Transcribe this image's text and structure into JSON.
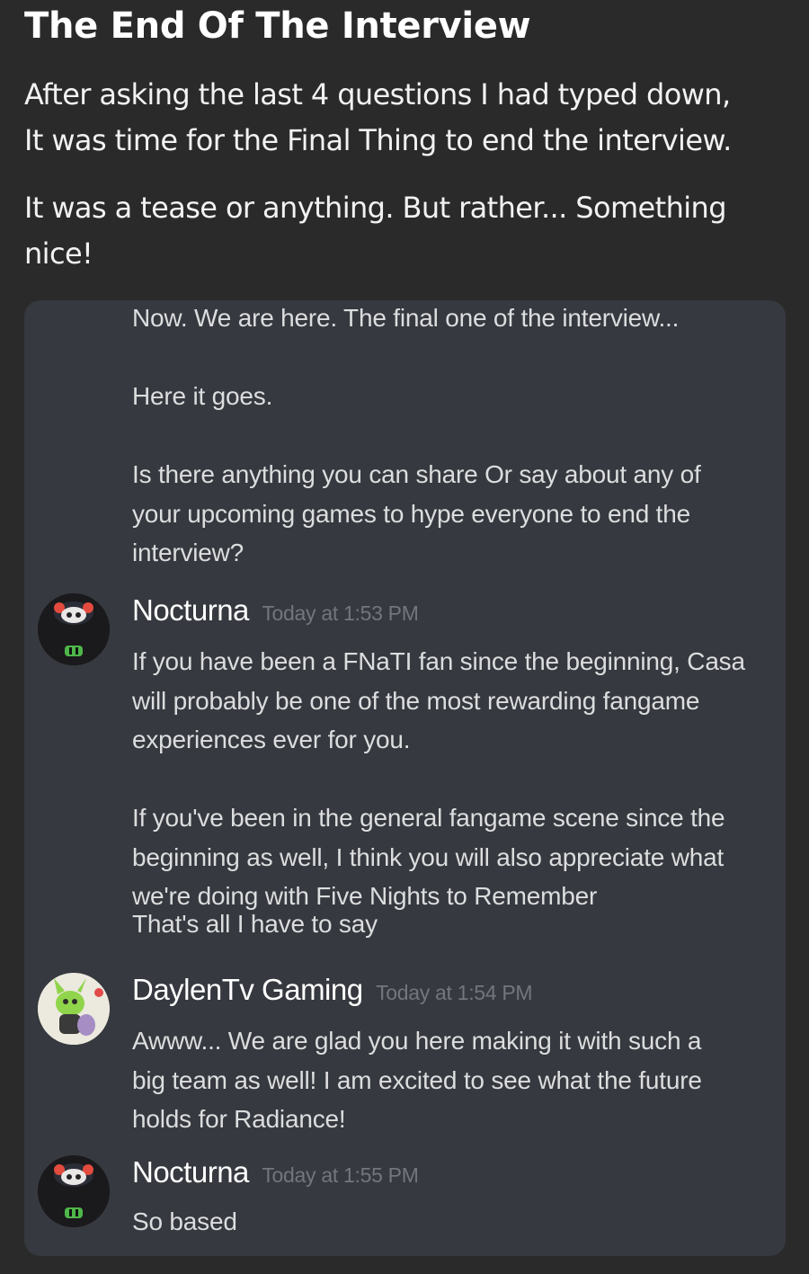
{
  "post": {
    "title": "The End Of The Interview",
    "paragraph1": [
      "After asking the last 4 questions I had typed down,",
      "It was time for the Final Thing to end the interview."
    ],
    "paragraph2": [
      "It was a tease or anything. But rather... Something",
      "nice!"
    ]
  },
  "chat": {
    "continued_messages": [
      [
        "Now. We are here. The final one of the interview..."
      ],
      [
        "Here it goes."
      ],
      [
        "Is there anything you can share Or say about any of",
        "your upcoming games to hype everyone to end the",
        "interview?"
      ]
    ],
    "messages": [
      {
        "author": "Nocturna",
        "timestamp": "Today at 1:53 PM",
        "avatar_icon": "nocturna-avatar-icon",
        "paragraphs": [
          [
            "If you have been a FNaTI fan since the beginning, Casa",
            "will probably be one of the most rewarding fangame",
            "experiences ever for you."
          ],
          [
            "If you've been in the general fangame scene since the",
            "beginning as well, I think you will also appreciate what",
            "we're doing with Five Nights to Remember",
            "That's all I have to say"
          ]
        ]
      },
      {
        "author": "DaylenTv Gaming",
        "timestamp": "Today at 1:54 PM",
        "avatar_icon": "daylentv-avatar-icon",
        "paragraphs": [
          [
            "Awww... We are glad you here making it with such a",
            "big team as well! I am excited to see what the future",
            "holds for Radiance!"
          ]
        ]
      },
      {
        "author": "Nocturna",
        "timestamp": "Today at 1:55 PM",
        "avatar_icon": "nocturna-avatar-icon",
        "paragraphs": [
          [
            "So based"
          ]
        ]
      }
    ]
  },
  "colors": {
    "page_background": "#2b2a2b",
    "card_background": "#36393f",
    "message_text": "#dcddde",
    "timestamp_text": "#72767d"
  }
}
